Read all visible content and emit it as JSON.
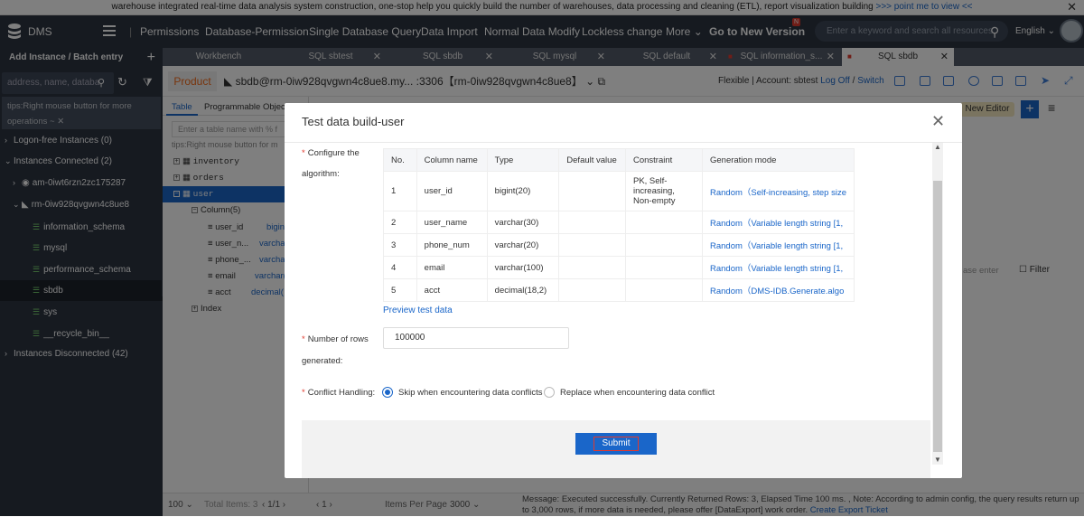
{
  "banner": {
    "text": "warehouse integrated real-time data analysis system construction, one-stop help you quickly build the number of warehouses, data processing and cleaning (ETL), report visualization building",
    "link": ">>> point me to view <<",
    "close": "✕"
  },
  "nav": {
    "logo": "DMS",
    "items": [
      "Permissions",
      "Database-Permission",
      "Single Database Query",
      "Data Import",
      "Normal Data Modify",
      "Lockless change",
      "More"
    ],
    "new_version": "Go to New Version",
    "new_badge": "N",
    "search_placeholder": "Enter a keyword and search all resources",
    "language": "English"
  },
  "sidebar": {
    "add_instance": "Add Instance / Batch entry",
    "search_placeholder": "address, name, databa",
    "tips": "tips:Right mouse button for more operations ~",
    "tree": [
      {
        "label": "Logon-free Instances",
        "count": "(0)"
      },
      {
        "label": "Instances Connected",
        "count": "(2)"
      },
      {
        "label": "am-0iwt6rzn2zc175287"
      },
      {
        "label": "rm-0iw928qvgwn4c8ue8"
      },
      {
        "label": "information_schema"
      },
      {
        "label": "mysql"
      },
      {
        "label": "performance_schema"
      },
      {
        "label": "sbdb"
      },
      {
        "label": "sys"
      },
      {
        "label": "__recycle_bin__"
      },
      {
        "label": "Instances Disconnected",
        "count": "(42)"
      }
    ]
  },
  "tabs": [
    {
      "label": "Workbench"
    },
    {
      "label": "SQL sbtest"
    },
    {
      "label": "SQL sbdb"
    },
    {
      "label": "SQL mysql"
    },
    {
      "label": "SQL default"
    },
    {
      "label": "SQL information_s..."
    },
    {
      "label": "SQL sbdb"
    }
  ],
  "product_bar": {
    "product": "Product",
    "connection": "sbdb@rm-0iw928qvgwn4c8ue8.my... :3306【rm-0iw928qvgwn4c8ue8】",
    "flexible": "Flexible | Account: sbtest",
    "logoff": "Log Off",
    "switch": "Switch"
  },
  "left_panel": {
    "tabs": [
      "Table",
      "Programmable Objec"
    ],
    "search_placeholder": "Enter a table name with % f",
    "tips": "tips:Right mouse button for m",
    "tables": [
      "inventory",
      "orders",
      "user"
    ],
    "column_group": "Column(5)",
    "columns": [
      {
        "name": "user_id",
        "type": "bigin"
      },
      {
        "name": "user_n...",
        "type": "varcha"
      },
      {
        "name": "phone_...",
        "type": "varcha"
      },
      {
        "name": "email",
        "type": "varchar("
      },
      {
        "name": "acct",
        "type": "decimal("
      }
    ],
    "index": "Index"
  },
  "right_panel": {
    "new_editor": "New Editor",
    "filter": "Filter",
    "filter_placeholder": "ase enter"
  },
  "bottom": {
    "page_size": "100",
    "total": "Total Items: 3",
    "pager": "1/1",
    "page": "1",
    "items_per_page_label": "Items Per Page",
    "items_per_page": "3000",
    "message": "Message: Executed successfully. Currently Returned Rows: 3, Elapsed Time 100 ms. , Note: According to admin config, the query results return up to 3,000 rows, if more data is needed, please offer [DataExport] work order.",
    "export_link": "Create Export Ticket"
  },
  "modal": {
    "title": "Test data build-user",
    "configure_label": "Configure the",
    "configure_label2": "algorithm:",
    "columns": [
      "No.",
      "Column name",
      "Type",
      "Default value",
      "Constraint",
      "Generation mode"
    ],
    "rows": [
      {
        "no": "1",
        "name": "user_id",
        "type": "bigint(20)",
        "default": "",
        "constraint": "PK, Self-increasing, Non-empty",
        "mode": "Random（Self-increasing, step size"
      },
      {
        "no": "2",
        "name": "user_name",
        "type": "varchar(30)",
        "default": "",
        "constraint": "",
        "mode": "Random（Variable length string [1,"
      },
      {
        "no": "3",
        "name": "phone_num",
        "type": "varchar(20)",
        "default": "",
        "constraint": "",
        "mode": "Random（Variable length string [1,"
      },
      {
        "no": "4",
        "name": "email",
        "type": "varchar(100)",
        "default": "",
        "constraint": "",
        "mode": "Random（Variable length string [1,"
      },
      {
        "no": "5",
        "name": "acct",
        "type": "decimal(18,2)",
        "default": "",
        "constraint": "",
        "mode": "Random（DMS-IDB.Generate.algo"
      }
    ],
    "preview": "Preview test data",
    "rows_label": "Number of rows",
    "rows_label2": "generated:",
    "rows_value": "100000",
    "conflict_label": "Conflict Handling:",
    "option_skip": "Skip when encountering data conflicts",
    "option_replace": "Replace when encountering data conflict",
    "submit": "Submit"
  }
}
